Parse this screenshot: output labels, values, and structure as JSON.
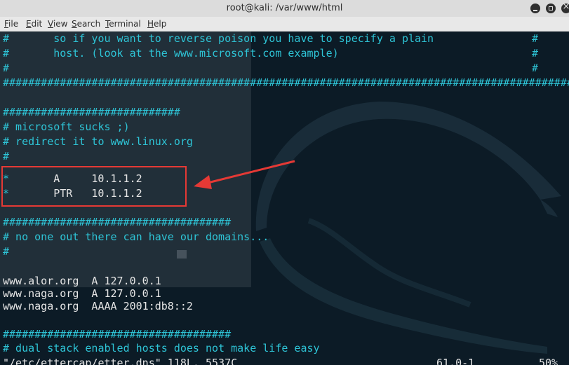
{
  "window": {
    "title": "root@kali: /var/www/html"
  },
  "menu": {
    "items": [
      "File",
      "Edit",
      "View",
      "Search",
      "Terminal",
      "Help"
    ]
  },
  "terminal": {
    "lines": {
      "l1": "#       so if you want to reverse poison you have to specify a plain",
      "l2": "#       host. (look at the www.microsoft.com example)",
      "l3": "#",
      "l4": "##########################################################################################",
      "l5": "",
      "l6": "############################",
      "l7": "# microsoft sucks ;)",
      "l8": "# redirect it to www.linux.org",
      "l9": "#",
      "l10": "",
      "l11_star": "*",
      "l11_text": "       A     10.1.1.2",
      "l12_star": "*",
      "l12_text": "       PTR   10.1.1.2",
      "l13": "",
      "l14": "####################################",
      "l15": "# no one out there can have our domains...",
      "l16": "#",
      "l17": "",
      "l18": "www.alor.org  A 127.0.0.1",
      "l19": "www.naga.org  A 127.0.0.1",
      "l20": "www.naga.org  AAAA 2001:db8::2",
      "l21": "",
      "l22": "####################################",
      "l23": "# dual stack enabled hosts does not make life easy"
    },
    "right_hash": "#",
    "status": {
      "file": "\"/etc/ettercap/etter.dns\" 118L, 5537C",
      "position": "61,0-1",
      "percent": "50%"
    }
  },
  "colors": {
    "comment": "#2ec4d6",
    "text": "#e6e6e6",
    "annotation": "#e53935",
    "background": "#0c1b26"
  }
}
